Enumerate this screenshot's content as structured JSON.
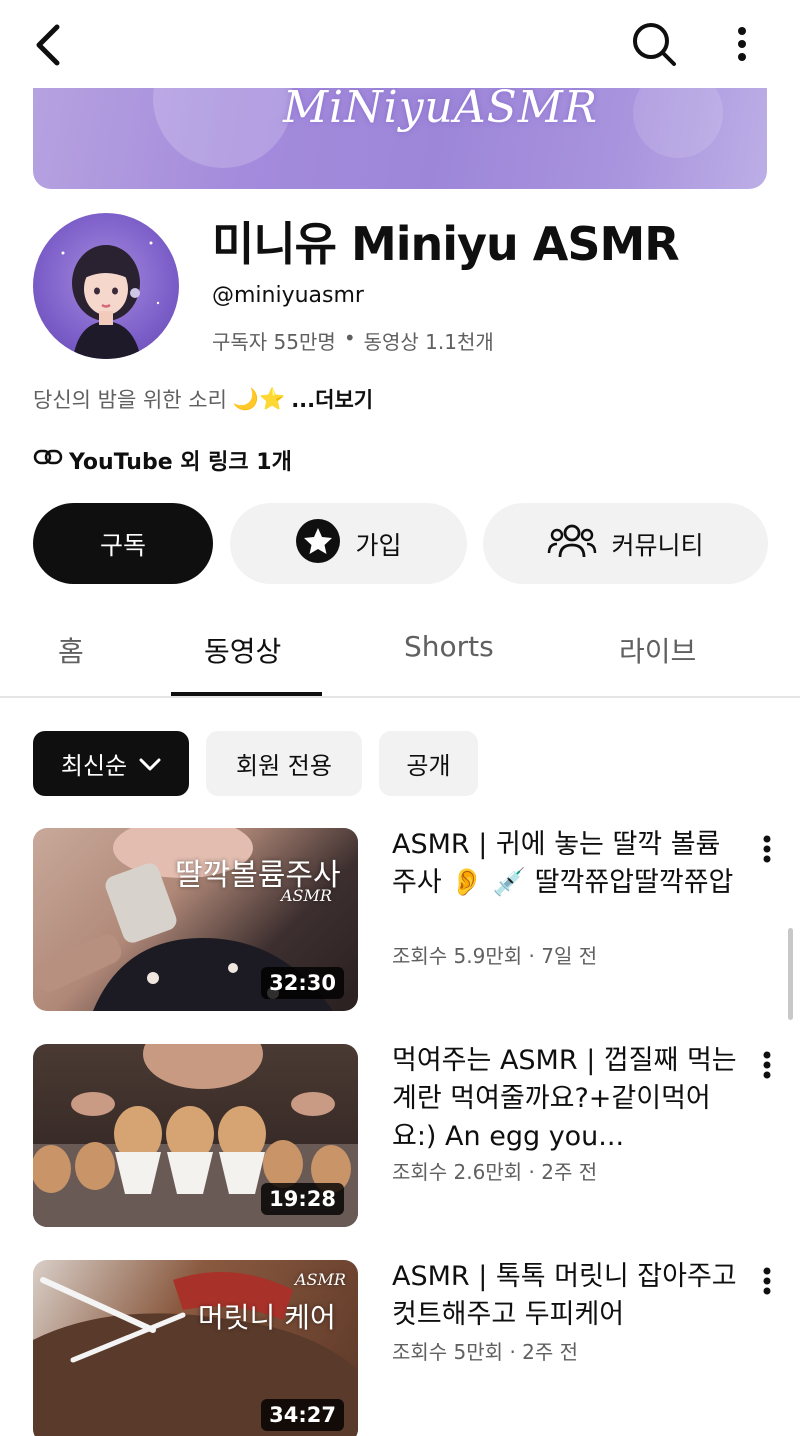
{
  "header": {
    "back_icon": "back-arrow-icon",
    "search_icon": "search-icon",
    "more_icon": "more-vert-icon"
  },
  "banner": {
    "logo_text": "MiNiyuASMR"
  },
  "channel": {
    "name": "미니유 Miniyu ASMR",
    "handle": "@miniyuasmr",
    "subscribers": "구독자 55만명",
    "separator": "•",
    "video_count": "동영상 1.1천개",
    "description": "당신의 밤을 위한 소리",
    "description_emoji": "🌙⭐",
    "more_link": "...더보기",
    "links": "YouTube 외 링크 1개"
  },
  "actions": {
    "subscribe": "구독",
    "join": "가입",
    "community": "커뮤니티"
  },
  "tabs": [
    {
      "label": "홈",
      "active": false
    },
    {
      "label": "동영상",
      "active": true
    },
    {
      "label": "Shorts",
      "active": false
    },
    {
      "label": "라이브",
      "active": false
    }
  ],
  "filters": {
    "sort": "최신순",
    "members_only": "회원 전용",
    "public": "공개"
  },
  "videos": [
    {
      "title": "ASMR | 귀에 놓는 딸깍 볼륨 주사 👂 💉 딸깍쮸압딸깍쮸압",
      "meta": "조회수 5.9만회 · 7일 전",
      "duration": "32:30",
      "thumb_text": "딸깍볼륨주사",
      "thumb_subtext": "ASMR"
    },
    {
      "title": "먹여주는 ASMR | 껍질째 먹는 계란 먹여줄까요?+같이먹어요:) An egg you...",
      "meta": "조회수 2.6만회 · 2주 전",
      "duration": "19:28"
    },
    {
      "title": "ASMR | 톡톡 머릿니 잡아주고 컷트해주고 두피케어",
      "meta": "조회수 5만회 · 2주 전",
      "duration": "34:27",
      "thumb_text": "머릿니 케어",
      "thumb_subtext": "ASMR"
    }
  ],
  "colors": {
    "primary": "#0f0f0f",
    "secondary_text": "#606060",
    "chip_bg": "#f2f2f2"
  }
}
